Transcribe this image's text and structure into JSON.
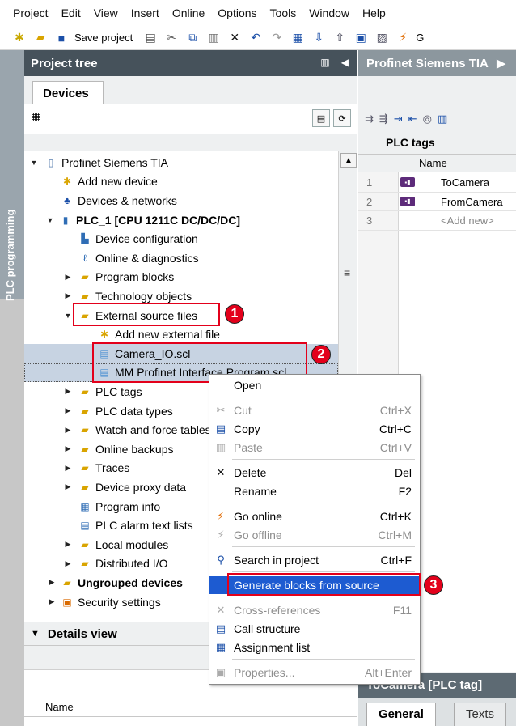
{
  "menu": [
    "Project",
    "Edit",
    "View",
    "Insert",
    "Online",
    "Options",
    "Tools",
    "Window",
    "Help"
  ],
  "toolbar": {
    "save_label": "Save project",
    "trailing": "G"
  },
  "side_tab": "PLC programming",
  "project_tree": {
    "title": "Project tree",
    "devices_tab": "Devices",
    "items": [
      {
        "label": "Profinet Siemens TIA",
        "icon": "project-icon"
      },
      {
        "label": "Add new device",
        "icon": "add-device-icon"
      },
      {
        "label": "Devices & networks",
        "icon": "network-icon"
      },
      {
        "label": "PLC_1 [CPU 1211C DC/DC/DC]",
        "icon": "plc-icon"
      },
      {
        "label": "Device configuration",
        "icon": "device-config-icon"
      },
      {
        "label": "Online & diagnostics",
        "icon": "diagnostics-icon"
      },
      {
        "label": "Program blocks",
        "icon": "folder-icon"
      },
      {
        "label": "Technology objects",
        "icon": "folder-icon"
      },
      {
        "label": "External source files",
        "icon": "folder-icon"
      },
      {
        "label": "Add new external file",
        "icon": "add-file-icon"
      },
      {
        "label": "Camera_IO.scl",
        "icon": "scl-file-icon"
      },
      {
        "label": "MM Profinet Interface Program.scl",
        "icon": "scl-file-icon"
      },
      {
        "label": "PLC tags",
        "icon": "folder-icon"
      },
      {
        "label": "PLC data types",
        "icon": "folder-icon"
      },
      {
        "label": "Watch and force tables",
        "icon": "folder-icon"
      },
      {
        "label": "Online backups",
        "icon": "folder-icon"
      },
      {
        "label": "Traces",
        "icon": "folder-icon"
      },
      {
        "label": "Device proxy data",
        "icon": "folder-icon"
      },
      {
        "label": "Program info",
        "icon": "program-info-icon"
      },
      {
        "label": "PLC alarm text lists",
        "icon": "alarm-list-icon"
      },
      {
        "label": "Local modules",
        "icon": "folder-icon"
      },
      {
        "label": "Distributed I/O",
        "icon": "folder-icon"
      },
      {
        "label": "Ungrouped devices",
        "icon": "folder-icon"
      },
      {
        "label": "Security settings",
        "icon": "security-icon"
      }
    ]
  },
  "annotations": [
    "1",
    "2",
    "3"
  ],
  "details_view": {
    "title": "Details view",
    "column": "Name"
  },
  "right_panel": {
    "title": "Profinet Siemens TIA",
    "table_title": "PLC tags",
    "column_name": "Name",
    "rows": [
      {
        "num": "1",
        "name": "ToCamera"
      },
      {
        "num": "2",
        "name": "FromCamera"
      },
      {
        "num": "3",
        "name": "<Add new>"
      }
    ],
    "inspector_title": "ToCamera [PLC tag]",
    "tabs": [
      "General",
      "Texts"
    ]
  },
  "context_menu": [
    {
      "label": "Open",
      "shortcut": "",
      "icon": "",
      "disabled": false
    },
    {
      "label": "Cut",
      "shortcut": "Ctrl+X",
      "icon": "cut-icon",
      "disabled": true
    },
    {
      "label": "Copy",
      "shortcut": "Ctrl+C",
      "icon": "copy-icon",
      "disabled": false
    },
    {
      "label": "Paste",
      "shortcut": "Ctrl+V",
      "icon": "paste-icon",
      "disabled": true
    },
    {
      "label": "Delete",
      "shortcut": "Del",
      "icon": "delete-icon",
      "disabled": false
    },
    {
      "label": "Rename",
      "shortcut": "F2",
      "icon": "",
      "disabled": false
    },
    {
      "label": "Go online",
      "shortcut": "Ctrl+K",
      "icon": "go-online-icon",
      "disabled": false
    },
    {
      "label": "Go offline",
      "shortcut": "Ctrl+M",
      "icon": "go-offline-icon",
      "disabled": true
    },
    {
      "label": "Search in project",
      "shortcut": "Ctrl+F",
      "icon": "search-project-icon",
      "disabled": false
    },
    {
      "label": "Generate blocks from source",
      "shortcut": "",
      "icon": "",
      "disabled": false
    },
    {
      "label": "Cross-references",
      "shortcut": "F11",
      "icon": "cross-ref-icon",
      "disabled": true
    },
    {
      "label": "Call structure",
      "shortcut": "",
      "icon": "call-structure-icon",
      "disabled": false
    },
    {
      "label": "Assignment list",
      "shortcut": "",
      "icon": "assignment-list-icon",
      "disabled": false
    },
    {
      "label": "Properties...",
      "shortcut": "Alt+Enter",
      "icon": "properties-icon",
      "disabled": true
    }
  ],
  "colors": {
    "highlight": "#1d5bd1",
    "annotation": "#e3001b",
    "header": "#46525b"
  }
}
